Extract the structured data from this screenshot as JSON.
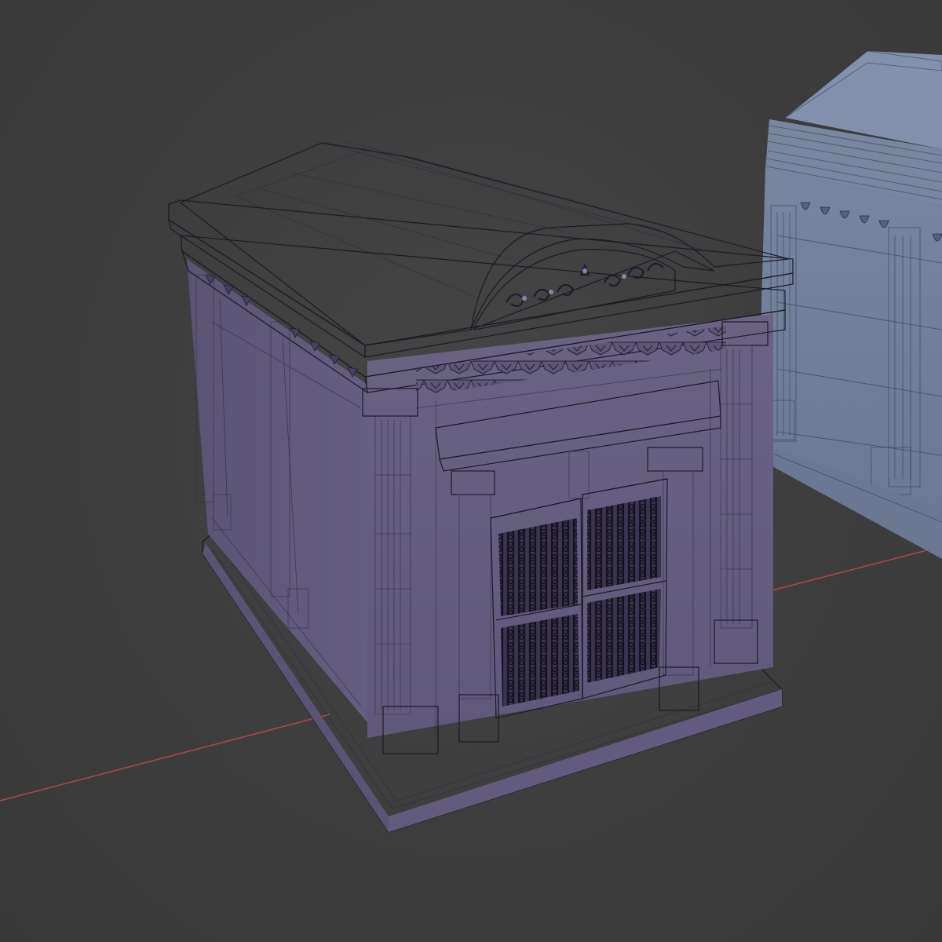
{
  "viewport": {
    "background_color": "#3d3d3d",
    "x_axis_color": "#b04848"
  },
  "objects": [
    {
      "name": "mausoleum-arched-roof",
      "material_color": "#6f6788",
      "state": "selected-foreground"
    },
    {
      "name": "mausoleum-gabled-roof",
      "material_color": "#6f7c95",
      "state": "background"
    }
  ],
  "icons": {
    "x-axis": "x-axis-line",
    "door": "iron-gate-icon",
    "ornament": "pediment-scroll-icon"
  }
}
